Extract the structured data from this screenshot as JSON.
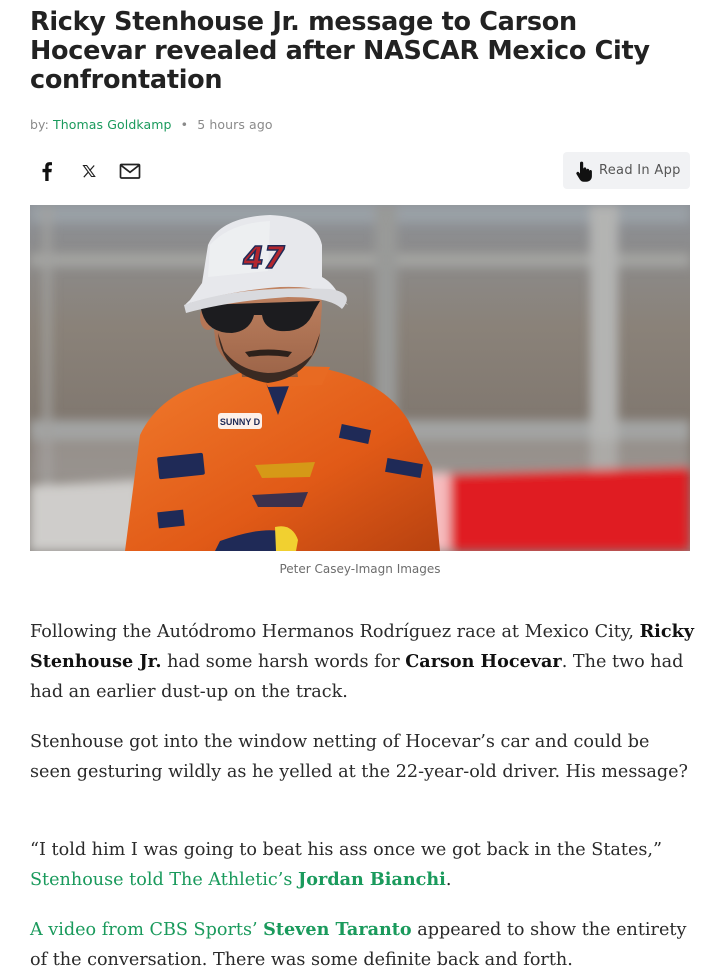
{
  "article": {
    "headline": "Ricky Stenhouse Jr. message to Carson Hocevar revealed after NASCAR Mexico City confrontation",
    "byline_prefix": "by:",
    "author": "Thomas Goldkamp",
    "separator": "•",
    "published": "5 hours ago"
  },
  "share": {
    "facebook_icon": "facebook-icon",
    "x_icon": "x-icon",
    "email_icon": "mail-icon",
    "read_in_app_label": "Read In App",
    "read_in_app_icon": "tap-hand-icon"
  },
  "hero": {
    "caption": "Peter Casey-Imagn Images",
    "cap_number": "47",
    "suit_patch": "SUNNY D",
    "chest_text": "SUNNY D"
  },
  "body": {
    "p1_a": "Following the Autódromo Hermanos Rodríguez race at Mexico City,",
    "p1_b": "Ricky Stenhouse Jr.",
    "p1_c": "had some harsh words for",
    "p1_d": "Carson Hocevar",
    "p1_e": ". The two had had an earlier dust-up on the track.",
    "p2": "Stenhouse got into the window netting of Hocevar’s car and could be seen gesturing wildly as he yelled at the 22-year-old driver. His message?",
    "p3_quote": "“I told him I was going to beat his ass once we got back in the States,”",
    "p3_link": "Stenhouse told The Athletic’s",
    "p3_link_bold": "Jordan Bianchi",
    "p3_end": ".",
    "p4_link": "A video from CBS Sports’",
    "p4_link_bold": "Steven Taranto",
    "p4_rest": "appeared to show the entirety of the conversation. There was some definite back and forth."
  },
  "colors": {
    "link": "#1a9a5c",
    "suit_orange": "#e8641e",
    "barrier_red": "#e01b22"
  }
}
